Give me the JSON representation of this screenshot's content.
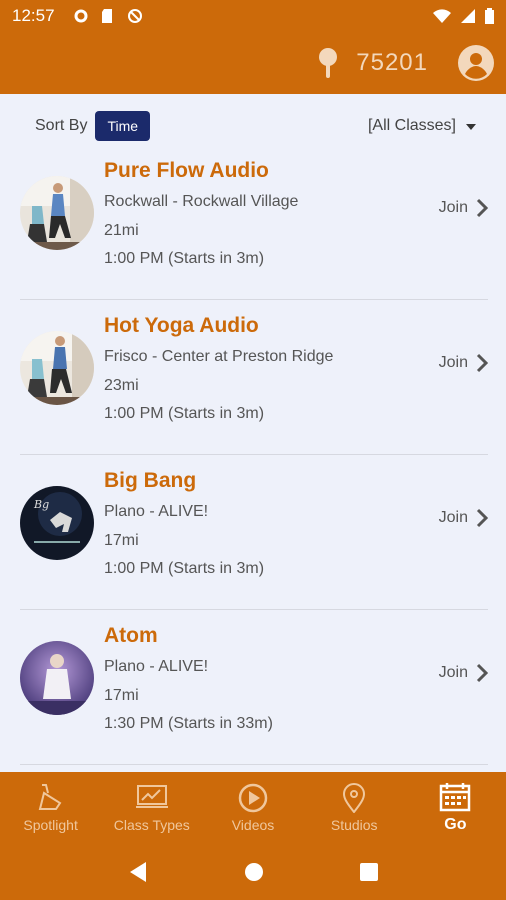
{
  "status_bar": {
    "time": "12:57",
    "icons": [
      "settings-icon",
      "sd-card-icon",
      "do-not-disturb-icon",
      "wifi-icon",
      "signal-icon",
      "battery-icon"
    ]
  },
  "header": {
    "location_icon": "pin-icon",
    "zip": "75201",
    "account_icon": "user-icon"
  },
  "sort": {
    "label": "Sort By",
    "selected": "Time",
    "filter": "[All Classes]"
  },
  "classes": [
    {
      "title": "Pure Flow Audio",
      "location": "Rockwall - Rockwall Village",
      "distance": "21mi",
      "time": "1:00 PM (Starts in 3m)",
      "action": "Join"
    },
    {
      "title": "Hot Yoga Audio",
      "location": "Frisco - Center at Preston Ridge",
      "distance": "23mi",
      "time": "1:00 PM (Starts in 3m)",
      "action": "Join"
    },
    {
      "title": "Big Bang",
      "location": "Plano - ALIVE!",
      "distance": "17mi",
      "time": "1:00 PM (Starts in 3m)",
      "action": "Join"
    },
    {
      "title": "Atom",
      "location": "Plano - ALIVE!",
      "distance": "17mi",
      "time": "1:30 PM (Starts in 33m)",
      "action": "Join"
    }
  ],
  "bottom_nav": {
    "items": [
      {
        "label": "Spotlight",
        "icon": "spotlight-icon"
      },
      {
        "label": "Class Types",
        "icon": "class-types-icon"
      },
      {
        "label": "Videos",
        "icon": "play-icon"
      },
      {
        "label": "Studios",
        "icon": "map-pin-icon"
      },
      {
        "label": "Go",
        "icon": "calendar-icon"
      }
    ],
    "active": "Go"
  },
  "colors": {
    "brand": "#cc6a0a",
    "sort_button": "#1b2a6b",
    "background": "#eef1fa"
  }
}
